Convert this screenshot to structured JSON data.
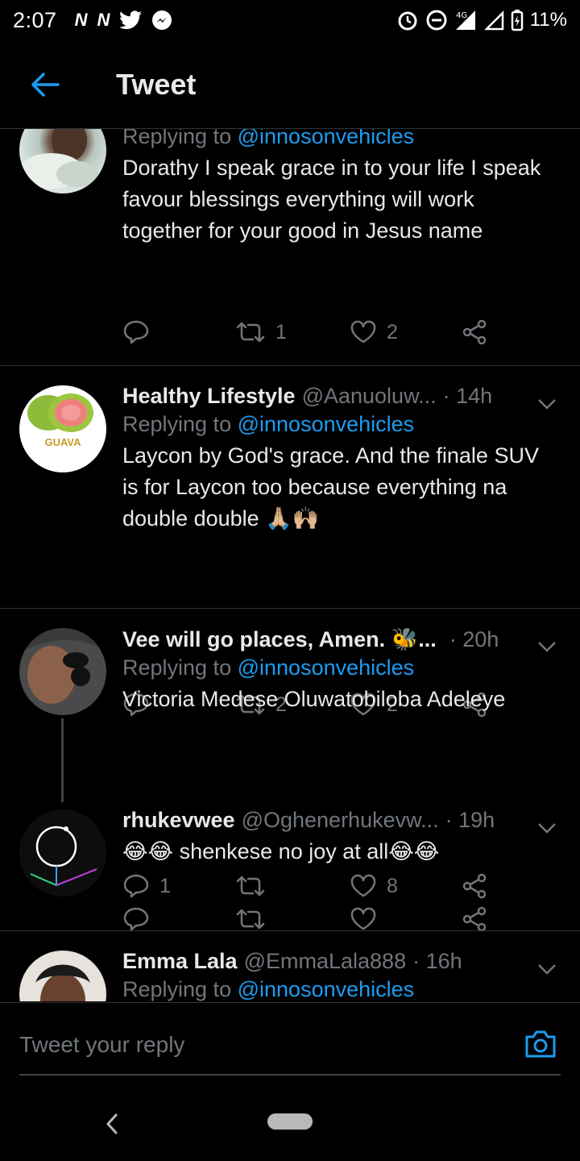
{
  "status_bar": {
    "time": "2:07",
    "notification_icons": [
      "N",
      "N"
    ],
    "battery": "11%",
    "network": "4G"
  },
  "header": {
    "title": "Tweet"
  },
  "tweets": [
    {
      "name": "",
      "handle": "",
      "time": "",
      "replying_prefix": "Replying to",
      "replying_to": "@innosonvehicles",
      "text": "Dorathy I speak grace in to your life I speak favour blessings everything will work together for your good in Jesus name",
      "replies": "",
      "retweets": "1",
      "likes": "2"
    },
    {
      "name": "Healthy Lifestyle",
      "handle": "@Aanuoluw...",
      "time": "· 14h",
      "replying_prefix": "Replying to",
      "replying_to": "@innosonvehicles",
      "text": "Laycon by God's grace. And the finale SUV is for Laycon too because everything na double double 🙏🏼🙌🏼",
      "replies": "",
      "retweets": "2",
      "likes": "2",
      "avatar_text": "GUAVA"
    },
    {
      "name": "Vee will go places, Amen. 🐝...",
      "handle": "",
      "time": "· 20h",
      "replying_prefix": "Replying to",
      "replying_to": "@innosonvehicles",
      "text": "Victoria Medese Oluwatobiloba Adeleye",
      "replies": "1",
      "retweets": "",
      "likes": "8"
    },
    {
      "name": "rhukevwee",
      "handle": "@Oghenerhukevw...",
      "time": "· 19h",
      "text": "😂😂 shenkese no joy at all😂😂",
      "replies": "",
      "retweets": "",
      "likes": ""
    },
    {
      "name": "Emma Lala",
      "handle": "@EmmaLala888",
      "time": "· 16h",
      "replying_prefix": "Replying to",
      "replying_to": "@innosonvehicles"
    }
  ],
  "reply_bar": {
    "placeholder": "Tweet your reply"
  },
  "colors": {
    "background": "#000000",
    "text": "#e7e9ea",
    "muted": "#71767b",
    "accent": "#1d9bf0",
    "divider": "#2f3336"
  }
}
